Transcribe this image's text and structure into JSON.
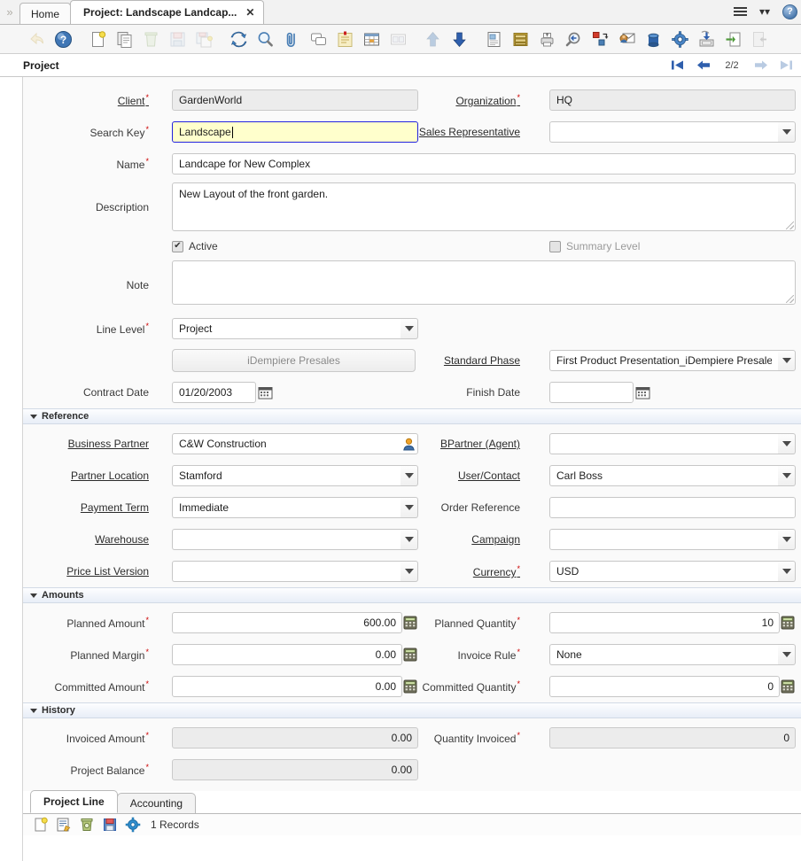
{
  "window": {
    "tabs": [
      {
        "label": "Home",
        "active": false,
        "closable": false
      },
      {
        "label": "Project: Landscape Landcap...",
        "active": true,
        "closable": true,
        "close": "✕"
      }
    ],
    "title": "Project",
    "nav": {
      "first": "first-record",
      "prev": "previous-record",
      "count": "2/2",
      "next": "next-record",
      "last": "last-record"
    }
  },
  "toolbar": {
    "buttons": [
      {
        "name": "undo-icon",
        "label": "Undo",
        "dim": true
      },
      {
        "name": "help-icon",
        "label": "Help",
        "dim": false
      },
      {
        "name": "new-record-icon",
        "label": "New Record",
        "dim": false
      },
      {
        "name": "copy-record-icon",
        "label": "Copy Record",
        "dim": false
      },
      {
        "name": "delete-record-icon",
        "label": "Delete Record",
        "dim": true
      },
      {
        "name": "save-record-icon",
        "label": "Save Changes",
        "dim": true
      },
      {
        "name": "save-create-icon",
        "label": "Save and Create New",
        "dim": true
      },
      {
        "name": "refresh-icon",
        "label": "Refresh",
        "dim": false
      },
      {
        "name": "find-icon",
        "label": "Find",
        "dim": false
      },
      {
        "name": "attachment-icon",
        "label": "Attachment",
        "dim": false
      },
      {
        "name": "chat-icon",
        "label": "Chat / Notes",
        "dim": false
      },
      {
        "name": "request-icon",
        "label": "Requests",
        "dim": false
      },
      {
        "name": "grid-toggle-icon",
        "label": "Toggle Grid View",
        "dim": false
      },
      {
        "name": "multi-form-icon",
        "label": "Multi Form",
        "dim": true
      },
      {
        "name": "parent-record-icon",
        "label": "Parent Record",
        "dim": true
      },
      {
        "name": "detail-record-icon",
        "label": "Detail Record",
        "dim": false
      },
      {
        "name": "report-icon",
        "label": "Report",
        "dim": false
      },
      {
        "name": "archive-icon",
        "label": "Archived Documents",
        "dim": false
      },
      {
        "name": "print-icon",
        "label": "Print",
        "dim": false
      },
      {
        "name": "print-preview-icon",
        "label": "Print Preview",
        "dim": false
      },
      {
        "name": "zoom-across-icon",
        "label": "Zoom Across",
        "dim": false
      },
      {
        "name": "active-workflow-icon",
        "label": "Active Workflow",
        "dim": false
      },
      {
        "name": "product-info-icon",
        "label": "Product Info",
        "dim": false
      },
      {
        "name": "preference-icon",
        "label": "Preference",
        "dim": false
      },
      {
        "name": "export-icon",
        "label": "Export",
        "dim": false
      },
      {
        "name": "csv-import-icon",
        "label": "CSV Import",
        "dim": false
      },
      {
        "name": "exit-icon",
        "label": "Exit",
        "dim": true
      }
    ]
  },
  "form": {
    "client": {
      "label": "Client",
      "value": "GardenWorld",
      "required": true
    },
    "organization": {
      "label": "Organization",
      "value": "HQ",
      "required": true
    },
    "search_key": {
      "label": "Search Key",
      "value": "Landscape",
      "required": true
    },
    "sales_rep": {
      "label": "Sales Representative",
      "value": ""
    },
    "name": {
      "label": "Name",
      "value": "Landcape for New Complex",
      "required": true
    },
    "description": {
      "label": "Description",
      "value": "New Layout of the front garden."
    },
    "active": {
      "label": "Active",
      "checked": true
    },
    "summary_level": {
      "label": "Summary Level",
      "checked": false
    },
    "note": {
      "label": "Note",
      "value": ""
    },
    "line_level": {
      "label": "Line Level",
      "value": "Project",
      "required": true
    },
    "presales_button": {
      "label": "iDempiere Presales"
    },
    "standard_phase": {
      "label": "Standard Phase",
      "value": "First Product Presentation_iDempiere Presale"
    },
    "contract_date": {
      "label": "Contract Date",
      "value": "01/20/2003"
    },
    "finish_date": {
      "label": "Finish Date",
      "value": ""
    }
  },
  "reference": {
    "title": "Reference",
    "business_partner": {
      "label": "Business Partner",
      "value": "C&W Construction"
    },
    "bpartner_agent": {
      "label": "BPartner (Agent)",
      "value": ""
    },
    "partner_location": {
      "label": "Partner Location",
      "value": "Stamford"
    },
    "user_contact": {
      "label": "User/Contact",
      "value": "Carl Boss"
    },
    "payment_term": {
      "label": "Payment Term",
      "value": "Immediate"
    },
    "order_reference": {
      "label": "Order Reference",
      "value": ""
    },
    "warehouse": {
      "label": "Warehouse",
      "value": ""
    },
    "campaign": {
      "label": "Campaign",
      "value": ""
    },
    "price_list_version": {
      "label": "Price List Version",
      "value": ""
    },
    "currency": {
      "label": "Currency",
      "value": "USD",
      "required": true
    }
  },
  "amounts": {
    "title": "Amounts",
    "planned_amount": {
      "label": "Planned Amount",
      "value": "600.00",
      "required": true
    },
    "planned_quantity": {
      "label": "Planned Quantity",
      "value": "10",
      "required": true
    },
    "planned_margin": {
      "label": "Planned Margin",
      "value": "0.00",
      "required": true
    },
    "invoice_rule": {
      "label": "Invoice Rule",
      "value": "None",
      "required": true
    },
    "committed_amount": {
      "label": "Committed Amount",
      "value": "0.00",
      "required": true
    },
    "committed_quantity": {
      "label": "Committed Quantity",
      "value": "0",
      "required": true
    }
  },
  "history": {
    "title": "History",
    "invoiced_amount": {
      "label": "Invoiced Amount",
      "value": "0.00",
      "required": true
    },
    "quantity_invoiced": {
      "label": "Quantity Invoiced",
      "value": "0",
      "required": true
    },
    "project_balance": {
      "label": "Project Balance",
      "value": "0.00",
      "required": true
    }
  },
  "bottom": {
    "tabs": [
      {
        "label": "Project Line",
        "active": true
      },
      {
        "label": "Accounting",
        "active": false
      }
    ],
    "actions": [
      {
        "name": "new-row-icon",
        "label": "New"
      },
      {
        "name": "edit-row-icon",
        "label": "Edit"
      },
      {
        "name": "delete-row-icon",
        "label": "Delete"
      },
      {
        "name": "save-row-icon",
        "label": "Save"
      },
      {
        "name": "row-settings-icon",
        "label": "Settings"
      }
    ],
    "records": "1 Records"
  },
  "colors": {
    "focus_field_bg": "#ffffcc",
    "focus_field_border": "#2222dd",
    "section_bar": "#e8eef7",
    "nav_blue": "#2f5fad",
    "required_mark": "#cc0000"
  }
}
